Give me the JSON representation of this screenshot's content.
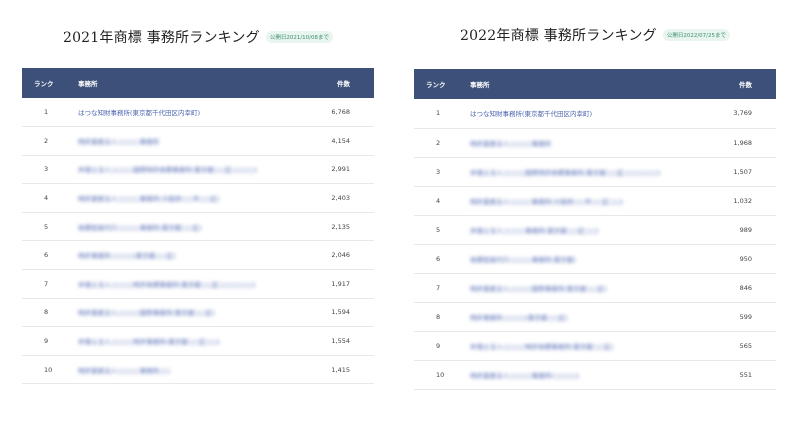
{
  "panels": [
    {
      "title": "2021年商標 事務所ランキング",
      "badge": "公開日2021/10/08まで",
      "headers": {
        "rank": "ランク",
        "firm": "事務所",
        "count": "件数"
      },
      "rows": [
        {
          "rank": "1",
          "firm": "はつな知財事務所(東京都千代田区内幸町)",
          "count": "6,768",
          "blurred": false
        },
        {
          "rank": "2",
          "firm": "特許業務法人○○○○事務所",
          "count": "4,154",
          "blurred": true
        },
        {
          "rank": "3",
          "firm": "弁理士法人○○○○国際特許商標事務所(東京都○○区○○○○)",
          "count": "2,991",
          "blurred": true
        },
        {
          "rank": "4",
          "firm": "特許業務法人○○○○事務所(大阪府○○市○○区)",
          "count": "2,403",
          "blurred": true
        },
        {
          "rank": "5",
          "firm": "商標登録代行○○○○事務所(東京都○○区)",
          "count": "2,135",
          "blurred": true
        },
        {
          "rank": "6",
          "firm": "特許事務所○○○○(東京都○○区)",
          "count": "2,046",
          "blurred": true
        },
        {
          "rank": "7",
          "firm": "弁理士法人○○○○特許商標事務所(東京都○○区○○○○○○)",
          "count": "1,917",
          "blurred": true
        },
        {
          "rank": "8",
          "firm": "特許業務法人○○○○国際事務所(東京都○○区)",
          "count": "1,594",
          "blurred": true
        },
        {
          "rank": "9",
          "firm": "弁理士法人○○○○特許事務所(東京都○○区○○)",
          "count": "1,554",
          "blurred": true
        },
        {
          "rank": "10",
          "firm": "特許業務法人○○○○事務所○○",
          "count": "1,415",
          "blurred": true
        }
      ]
    },
    {
      "title": "2022年商標 事務所ランキング",
      "badge": "公開日2022/07/25まで",
      "headers": {
        "rank": "ランク",
        "firm": "事務所",
        "count": "件数"
      },
      "rows": [
        {
          "rank": "1",
          "firm": "はつな知財事務所(東京都千代田区内幸町)",
          "count": "3,769",
          "blurred": false
        },
        {
          "rank": "2",
          "firm": "特許業務法人○○○○事務所",
          "count": "1,968",
          "blurred": true
        },
        {
          "rank": "3",
          "firm": "弁理士法人○○○○国際特許商標事務所(東京都○○区○○○○○○)",
          "count": "1,507",
          "blurred": true
        },
        {
          "rank": "4",
          "firm": "特許業務法人○○○○事務所(大阪府○○市○○区○○)",
          "count": "1,032",
          "blurred": true
        },
        {
          "rank": "5",
          "firm": "弁理士法人○○○○事務所(東京都○○区○○)",
          "count": "989",
          "blurred": true
        },
        {
          "rank": "6",
          "firm": "商標登録代行○○○○事務所(東京都)",
          "count": "950",
          "blurred": true
        },
        {
          "rank": "7",
          "firm": "特許業務法人○○○○国際事務所(東京都○○区)",
          "count": "846",
          "blurred": true
        },
        {
          "rank": "8",
          "firm": "特許事務所○○○○(東京都○○区)",
          "count": "599",
          "blurred": true
        },
        {
          "rank": "9",
          "firm": "弁理士法人○○○○特許商標事務所(東京都○○区)",
          "count": "565",
          "blurred": true
        },
        {
          "rank": "10",
          "firm": "特許業務法人○○○○事務所(○○○○)",
          "count": "551",
          "blurred": true
        }
      ]
    }
  ]
}
